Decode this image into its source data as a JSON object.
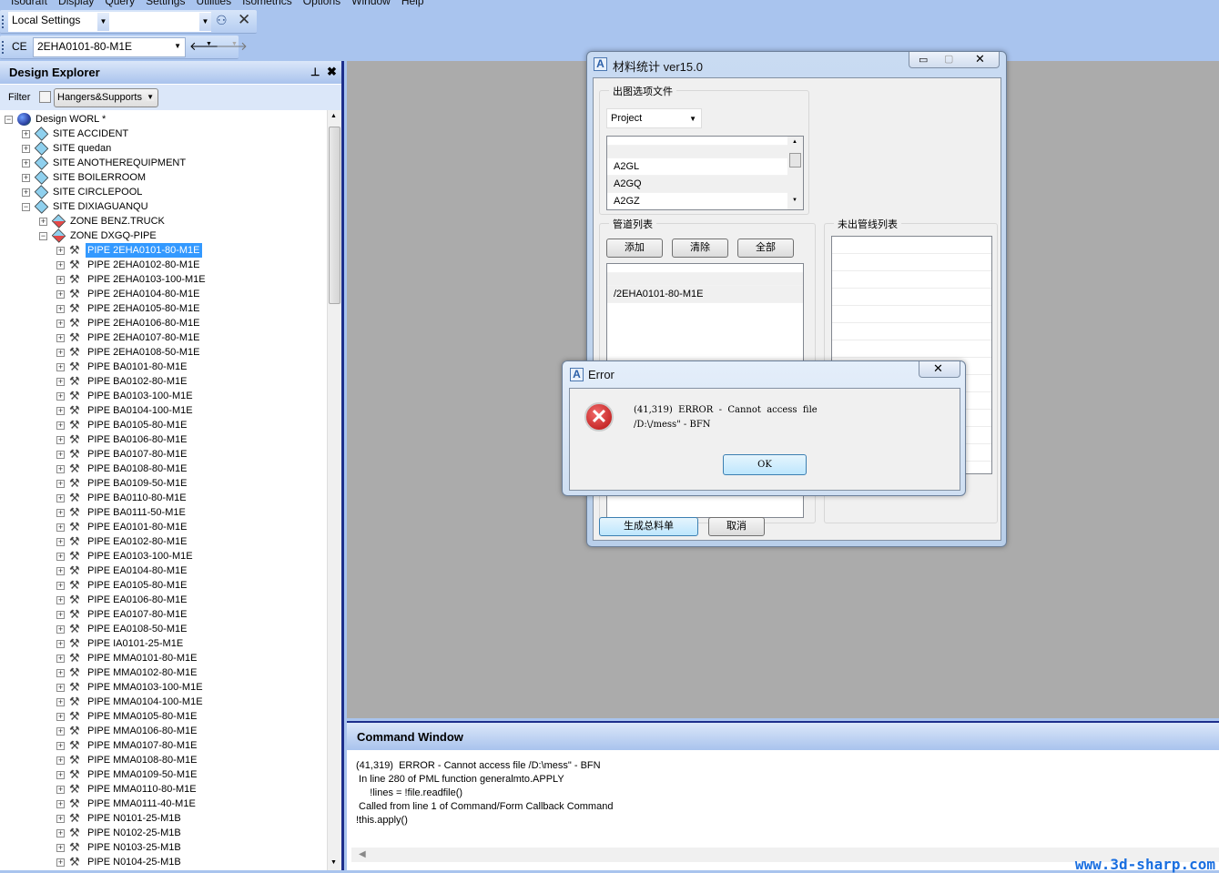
{
  "menubar": {
    "items": [
      "Isodraft",
      "Display",
      "Query",
      "Settings",
      "Utilities",
      "Isometrics",
      "Options",
      "Window",
      "Help"
    ]
  },
  "toolbar": {
    "settings_value": "Local Settings",
    "search_value": "",
    "ce_label": "CE",
    "ce_value": "2EHA0101-80-M1E"
  },
  "explorer": {
    "title": "Design Explorer",
    "filter_label": "Filter",
    "filter_checked": false,
    "filter_value": "Hangers&Supports",
    "root": "Design WORL *",
    "sites": [
      "SITE ACCIDENT",
      "SITE quedan",
      "SITE ANOTHEREQUIPMENT",
      "SITE BOILERROOM",
      "SITE CIRCLEPOOL",
      "SITE DIXIAGUANQU"
    ],
    "zones": [
      "ZONE BENZ.TRUCK",
      "ZONE DXGQ-PIPE"
    ],
    "pipes": [
      "PIPE 2EHA0101-80-M1E",
      "PIPE 2EHA0102-80-M1E",
      "PIPE 2EHA0103-100-M1E",
      "PIPE 2EHA0104-80-M1E",
      "PIPE 2EHA0105-80-M1E",
      "PIPE 2EHA0106-80-M1E",
      "PIPE 2EHA0107-80-M1E",
      "PIPE 2EHA0108-50-M1E",
      "PIPE BA0101-80-M1E",
      "PIPE BA0102-80-M1E",
      "PIPE BA0103-100-M1E",
      "PIPE BA0104-100-M1E",
      "PIPE BA0105-80-M1E",
      "PIPE BA0106-80-M1E",
      "PIPE BA0107-80-M1E",
      "PIPE BA0108-80-M1E",
      "PIPE BA0109-50-M1E",
      "PIPE BA0110-80-M1E",
      "PIPE BA0111-50-M1E",
      "PIPE EA0101-80-M1E",
      "PIPE EA0102-80-M1E",
      "PIPE EA0103-100-M1E",
      "PIPE EA0104-80-M1E",
      "PIPE EA0105-80-M1E",
      "PIPE EA0106-80-M1E",
      "PIPE EA0107-80-M1E",
      "PIPE EA0108-50-M1E",
      "PIPE IA0101-25-M1E",
      "PIPE MMA0101-80-M1E",
      "PIPE MMA0102-80-M1E",
      "PIPE MMA0103-100-M1E",
      "PIPE MMA0104-100-M1E",
      "PIPE MMA0105-80-M1E",
      "PIPE MMA0106-80-M1E",
      "PIPE MMA0107-80-M1E",
      "PIPE MMA0108-80-M1E",
      "PIPE MMA0109-50-M1E",
      "PIPE MMA0110-80-M1E",
      "PIPE MMA0111-40-M1E",
      "PIPE N0101-25-M1B",
      "PIPE N0102-25-M1B",
      "PIPE N0103-25-M1B",
      "PIPE N0104-25-M1B"
    ],
    "selected_index": 0
  },
  "command_window": {
    "title": "Command Window",
    "lines": "(41,319)  ERROR - Cannot access file /D:\\mess\" - BFN\n In line 280 of PML function generalmto.APPLY\n     !lines = !file.readfile()\n Called from line 1 of Command/Form Callback Command\n!this.apply()"
  },
  "material_dialog": {
    "title": "材料统计 ver15.0",
    "group1_title": "出图选项文件",
    "project_value": "Project",
    "options": [
      "",
      "A2GL",
      "A2GQ",
      "A2GZ"
    ],
    "group2_title": "管道列表",
    "add_label": "添加",
    "clear_label": "清除",
    "all_label": "全部",
    "pipe_list": [
      "",
      "/2EHA0101-80-M1E"
    ],
    "group3_title": "未出管线列表",
    "generate_label": "生成总料单",
    "cancel_label": "取消"
  },
  "error_dialog": {
    "title": "Error",
    "message_line1": "(41,319)  ERROR  -  Cannot  access  file",
    "message_line2": "/D:\\/mess\" - BFN",
    "ok_label": "OK"
  },
  "watermark": "www.3d-sharp.com"
}
